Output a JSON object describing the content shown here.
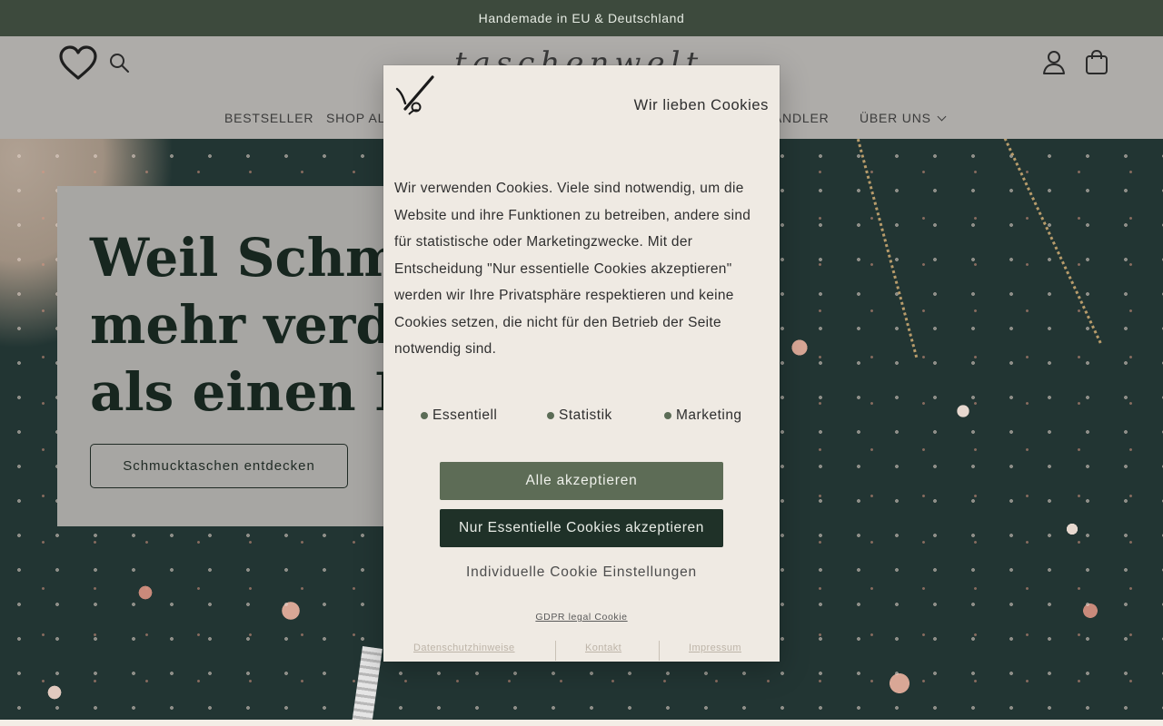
{
  "announcement": {
    "text": "Handemade in EU & Deutschland"
  },
  "header": {
    "logo_text": "taschenwelt",
    "nav": [
      "BESTSELLER",
      "SHOP AL",
      "HÄNDLER",
      "ÜBER UNS"
    ]
  },
  "hero": {
    "title": "Weil Schmuck mehr verdient als einen Beutel",
    "button_label": "Schmucktaschen entdecken"
  },
  "cookie_modal": {
    "title": "Wir lieben Cookies",
    "body": "Wir verwenden Cookies. Viele sind notwendig, um die Website und ihre Funktionen zu betreiben, andere sind für statistische oder Marketingzwecke. Mit der Entscheidung \"Nur essentielle Cookies akzeptieren\" werden wir Ihre Privatsphäre respektieren und keine Cookies setzen, die nicht für den Betrieb der Seite notwendig sind.",
    "categories": [
      "Essentiell",
      "Statistik",
      "Marketing"
    ],
    "accept_all": "Alle akzeptieren",
    "accept_essential": "Nur Essentielle Cookies akzeptieren",
    "individual": "Individuelle Cookie Einstellungen",
    "gdpr_link": "GDPR legal Cookie",
    "footer_links": [
      "Datenschutzhinweise",
      "Kontakt",
      "Impressum"
    ]
  },
  "colors": {
    "announcement_bg": "#3d4a3d",
    "accept_all_bg": "#5d6c56",
    "accept_essential_bg": "#1f3128",
    "modal_bg": "#efeae3"
  }
}
